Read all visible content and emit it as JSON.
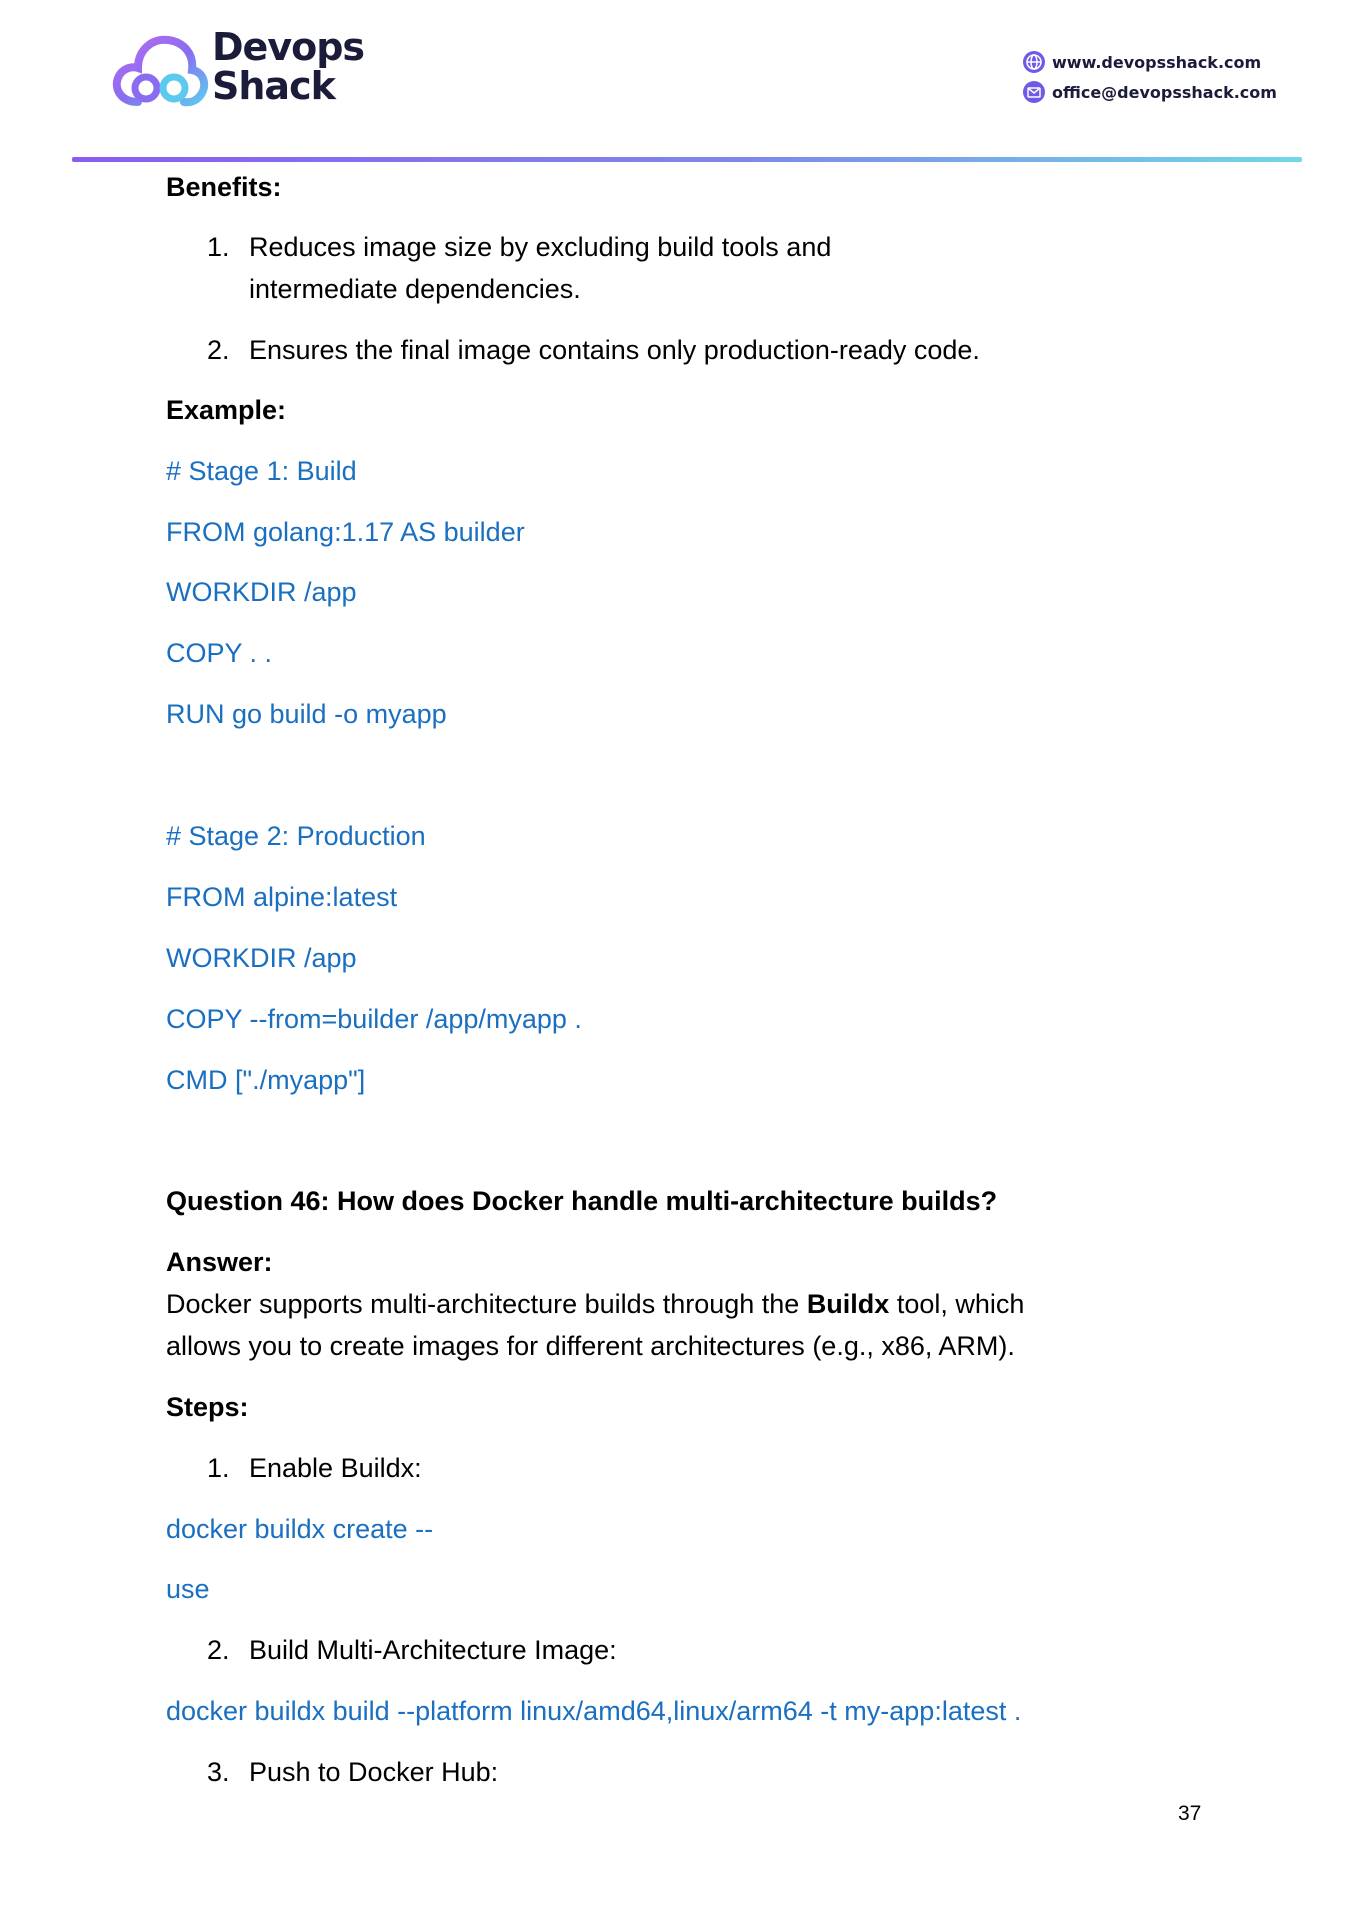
{
  "header": {
    "brand_line1": "Devops",
    "brand_line2": "Shack",
    "website": "www.devopsshack.com",
    "email": "office@devopsshack.com",
    "website_icon": "globe-icon",
    "email_icon": "mail-icon",
    "rule_colors": [
      "#8a5cf0",
      "#7e88ea",
      "#6fd8e6"
    ]
  },
  "content": {
    "benefits_heading": "Benefits:",
    "benefits": [
      {
        "num": "1.",
        "line1": "Reduces image size by excluding build tools and",
        "line2": "intermediate dependencies."
      },
      {
        "num": "2.",
        "line1": "Ensures the final image contains only production-ready code."
      }
    ],
    "example_heading": "Example:",
    "code_stage1": [
      "# Stage 1: Build",
      "FROM golang:1.17 AS builder",
      "WORKDIR /app",
      "COPY . .",
      "RUN go build -o myapp"
    ],
    "code_stage2": [
      "# Stage 2: Production",
      "FROM alpine:latest",
      "WORKDIR /app",
      "COPY --from=builder /app/myapp .",
      "CMD [\"./myapp\"]"
    ],
    "question": "Question 46: How does Docker handle multi-architecture builds?",
    "answer_heading": "Answer:",
    "answer_pre": "Docker supports multi-architecture builds through the ",
    "answer_bold": "Buildx",
    "answer_post": " tool, which",
    "answer_line2": "allows you to create images for different architectures (e.g., x86, ARM).",
    "steps_heading": "Steps:",
    "steps": [
      {
        "num": "1.",
        "label": "Enable Buildx:",
        "code": [
          "docker buildx create --",
          "use"
        ]
      },
      {
        "num": "2.",
        "label": "Build Multi-Architecture Image:",
        "code": [
          "docker buildx build --platform linux/amd64,linux/arm64 -t my-app:latest ."
        ]
      },
      {
        "num": "3.",
        "label": "Push to Docker Hub:"
      }
    ],
    "code_color": "#1a6fc0"
  },
  "page_number": "37"
}
